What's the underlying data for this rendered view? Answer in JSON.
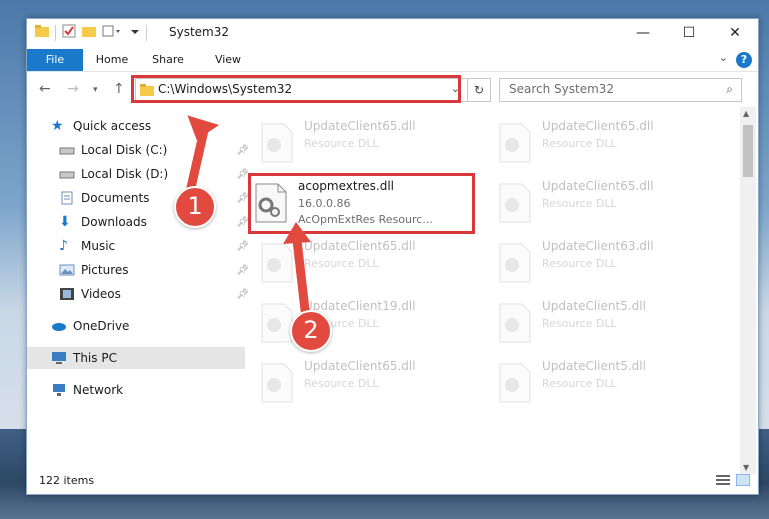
{
  "window": {
    "title": "System32"
  },
  "window_controls": {
    "minimize": "—",
    "maximize": "☐",
    "close": "✕"
  },
  "ribbon": {
    "tabs": [
      "File",
      "Home",
      "Share",
      "View"
    ],
    "help": "?"
  },
  "address": {
    "path": "C:\\Windows\\System32"
  },
  "search": {
    "placeholder": "Search System32"
  },
  "nav": {
    "items": [
      {
        "label": "Quick access",
        "icon": "star-icon"
      },
      {
        "label": "Local Disk (C:)",
        "icon": "drive-icon",
        "pinned": true
      },
      {
        "label": "Local Disk (D:)",
        "icon": "drive-icon",
        "pinned": true
      },
      {
        "label": "Documents",
        "icon": "documents-icon",
        "pinned": true
      },
      {
        "label": "Downloads",
        "icon": "download-icon",
        "pinned": true
      },
      {
        "label": "Music",
        "icon": "music-icon",
        "pinned": true
      },
      {
        "label": "Pictures",
        "icon": "pictures-icon",
        "pinned": true
      },
      {
        "label": "Videos",
        "icon": "videos-icon",
        "pinned": true
      },
      {
        "label": "OneDrive",
        "icon": "cloud-icon"
      },
      {
        "label": "This PC",
        "icon": "pc-icon",
        "selected": true
      },
      {
        "label": "Network",
        "icon": "network-icon"
      }
    ]
  },
  "files": {
    "highlighted": {
      "name": "acopmextres.dll",
      "version": "16.0.0.86",
      "description": "AcOpmExtRes Resourc..."
    },
    "ghost_left": [
      {
        "name": "UpdateClient65.dll",
        "type": "Resource DLL"
      },
      {
        "name": "UpdateClient65.dll",
        "type": "Resource DLL"
      },
      {
        "name": "UpdateClient19.dll",
        "type": "Resource DLL"
      },
      {
        "name": "UpdateClient65.dll",
        "type": "Resource DLL"
      }
    ],
    "ghost_right": [
      {
        "name": "UpdateClient65.dll",
        "type": "Resource DLL"
      },
      {
        "name": "UpdateClient65.dll",
        "type": "Resource DLL"
      },
      {
        "name": "UpdateClient63.dll",
        "type": "Resource DLL"
      },
      {
        "name": "UpdateClient5.dll",
        "type": "Resource DLL"
      },
      {
        "name": "UpdateClient5.dll",
        "type": "Resource DLL"
      }
    ]
  },
  "status": {
    "items": "122 items"
  },
  "annotations": {
    "step1": "1",
    "step2": "2",
    "color": "#e34a3f"
  }
}
